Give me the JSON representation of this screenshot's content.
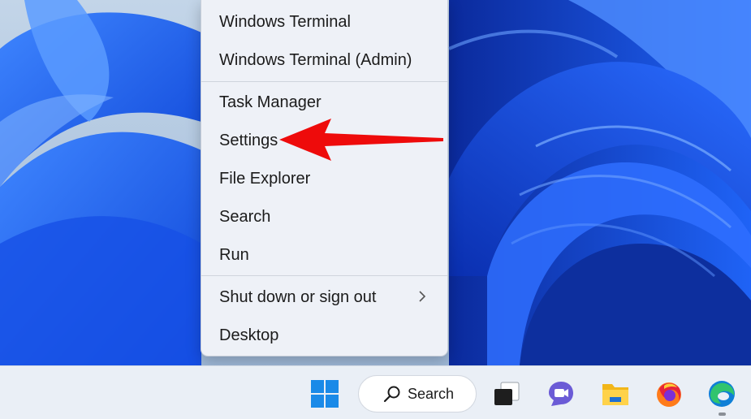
{
  "menu": {
    "items": [
      {
        "label": "Windows Terminal"
      },
      {
        "label": "Windows Terminal (Admin)"
      },
      {
        "label": "Task Manager"
      },
      {
        "label": "Settings"
      },
      {
        "label": "File Explorer"
      },
      {
        "label": "Search"
      },
      {
        "label": "Run"
      },
      {
        "label": "Shut down or sign out"
      },
      {
        "label": "Desktop"
      }
    ]
  },
  "taskbar": {
    "search_label": "Search",
    "icons": [
      "windows-start-icon",
      "search-icon",
      "task-view-icon",
      "teams-chat-icon",
      "file-explorer-icon",
      "firefox-icon",
      "edge-icon"
    ]
  },
  "colors": {
    "menu_bg": "#eef1f7",
    "taskbar_bg": "#eaeff6",
    "arrow": "#ee0b0b",
    "wallpaper_blue": "#1e63f2"
  }
}
